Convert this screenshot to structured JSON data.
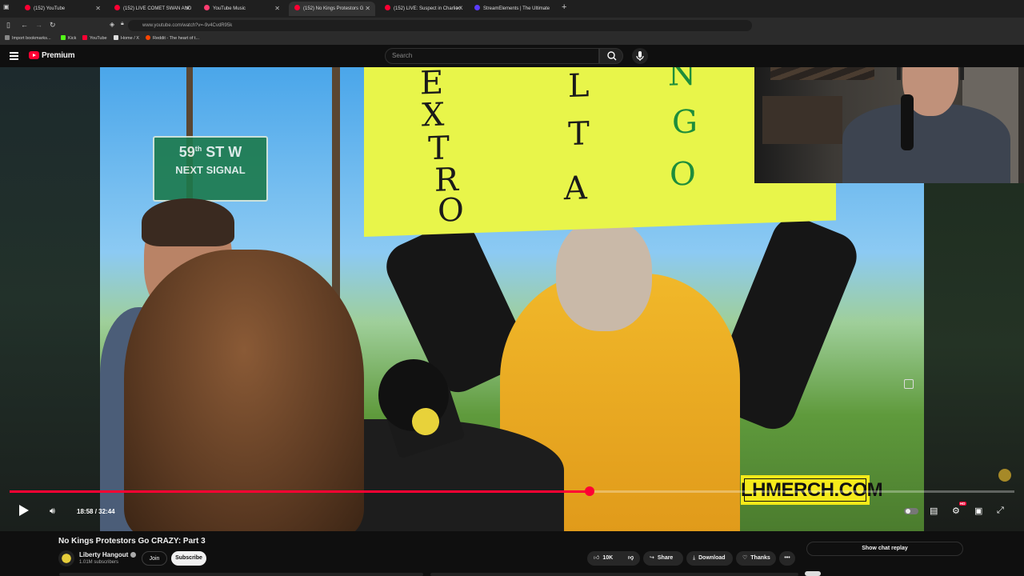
{
  "browser": {
    "tabs": [
      {
        "label": "(152) YouTube",
        "icon": "youtube-icon"
      },
      {
        "label": "(152) LIVE COMET SWAN AND",
        "icon": "youtube-icon"
      },
      {
        "label": "YouTube Music",
        "icon": "youtube-music-icon"
      },
      {
        "label": "(152) No Kings Protestors G",
        "icon": "youtube-icon",
        "active": true
      },
      {
        "label": "(152) LIVE: Suspect in Charlie K",
        "icon": "youtube-icon"
      },
      {
        "label": "StreamElements | The Ultimate",
        "icon": "streamelements-icon"
      }
    ],
    "url": "www.youtube.com/watch?v=-9v4CvdR95k",
    "bookmarks": [
      {
        "label": "Import bookmarks...",
        "color": "#888888"
      },
      {
        "label": "Kick",
        "color": "#53fc18"
      },
      {
        "label": "YouTube",
        "color": "#ff0033"
      },
      {
        "label": "Home / X",
        "color": "#dddddd"
      },
      {
        "label": "Reddit - The heart of t...",
        "color": "#ff4500"
      }
    ]
  },
  "youtube": {
    "brand": "Premium",
    "search_placeholder": "Search"
  },
  "video": {
    "sign_line1": "59",
    "sign_line1_sup": "th",
    "sign_line1_rest": " ST W",
    "sign_line2": "NEXT SIGNAL",
    "poster_letters": [
      "E",
      "X",
      "T",
      "R",
      "O",
      "T",
      "L",
      "T",
      "A",
      "N",
      "G",
      "O"
    ],
    "overlay_text": "LHMERCH.COM",
    "progress_fraction": 0.577,
    "time_current": "18:58",
    "time_separator": " / ",
    "time_total": "32:44",
    "hd_badge": "HD"
  },
  "details": {
    "title": "No Kings Protestors Go CRAZY: Part 3",
    "channel": "Liberty Hangout",
    "subscribers": "1.01M subscribers",
    "join_label": "Join",
    "subscribe_label": "Subscribe",
    "likes": "10K",
    "share_label": "Share",
    "download_label": "Download",
    "thanks_label": "Thanks",
    "chat_replay_label": "Show chat replay"
  },
  "colors": {
    "accent": "#ff0033",
    "overlay_yellow": "#f5ea1a"
  }
}
